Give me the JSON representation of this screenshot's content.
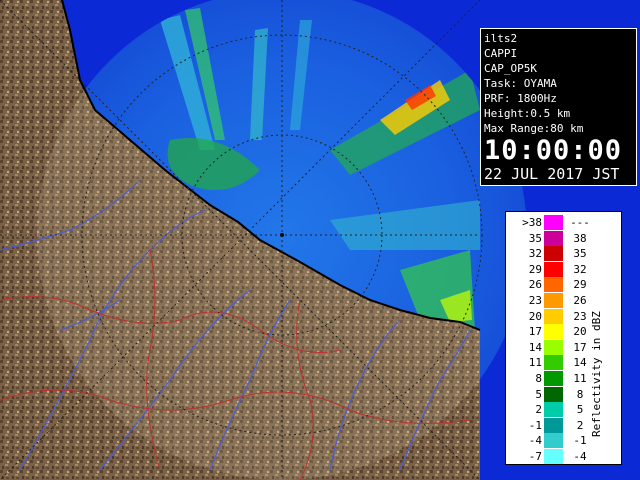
{
  "info": {
    "site": "ilts2",
    "product": "CAPPI",
    "operation": "CAP_OP5K",
    "task": "Task: OYAMA",
    "prf": "PRF: 1800Hz",
    "height": "Height:0.5 km",
    "max_range": "Max Range:80 km",
    "time": "10:00:00",
    "date": "22 JUL 2017 JST"
  },
  "legend": {
    "title": "Reflectivity in dBZ",
    "rows": [
      {
        "lo": ">38",
        "hi": "---",
        "color": "#ff00ff"
      },
      {
        "lo": "35",
        "hi": "38",
        "color": "#cc0099"
      },
      {
        "lo": "32",
        "hi": "35",
        "color": "#cc0000"
      },
      {
        "lo": "29",
        "hi": "32",
        "color": "#ff0000"
      },
      {
        "lo": "26",
        "hi": "29",
        "color": "#ff6600"
      },
      {
        "lo": "23",
        "hi": "26",
        "color": "#ff9900"
      },
      {
        "lo": "20",
        "hi": "23",
        "color": "#ffcc00"
      },
      {
        "lo": "17",
        "hi": "20",
        "color": "#ffff00"
      },
      {
        "lo": "14",
        "hi": "17",
        "color": "#99ff00"
      },
      {
        "lo": "11",
        "hi": "14",
        "color": "#33cc00"
      },
      {
        "lo": "8",
        "hi": "11",
        "color": "#009900"
      },
      {
        "lo": "5",
        "hi": "8",
        "color": "#006600"
      },
      {
        "lo": "2",
        "hi": "5",
        "color": "#00ccaa"
      },
      {
        "lo": "-1",
        "hi": "2",
        "color": "#009999"
      },
      {
        "lo": "-4",
        "hi": "-1",
        "color": "#33cccc"
      },
      {
        "lo": "-7",
        "hi": "-4",
        "color": "#66ffff"
      }
    ]
  },
  "colors": {
    "sea": "#0b2ad6",
    "sea_echo": "#1a6fe0",
    "land": "#7a6045",
    "land_dark": "#4a3828",
    "range_ring": "#222222",
    "coast": "#000000",
    "river": "#4a5cd8",
    "boundary": "#c03030"
  }
}
